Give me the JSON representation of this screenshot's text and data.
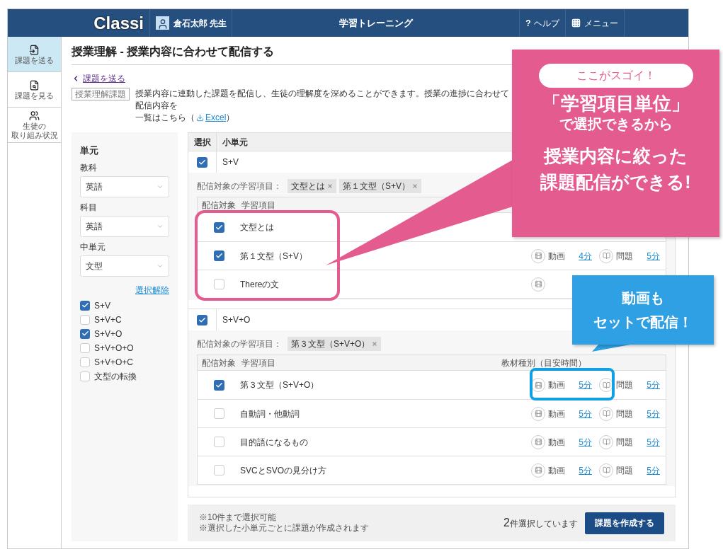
{
  "header": {
    "logo": "Classi",
    "user": "倉石太郎 先生",
    "title": "学習トレーニング",
    "help": {
      "mark": "?",
      "label": "ヘルプ"
    },
    "menu": "メニュー"
  },
  "rail": [
    {
      "kind": "send",
      "lines": [
        "課題を送る"
      ],
      "selected": true
    },
    {
      "kind": "view",
      "lines": [
        "課題を見る"
      ],
      "selected": false
    },
    {
      "kind": "students",
      "lines": [
        "生徒の",
        "取り組み状況"
      ],
      "selected": false
    }
  ],
  "page_title": "授業理解 - 授業内容に合わせて配信する",
  "back_link": "課題を送る",
  "badge": "授業理解課題",
  "description": "授業内容に連動した課題を配信し、生徒の理解度を深めることができます。授業の進捗に合わせて配信内容を",
  "list_line": {
    "before": "一覧はこちら（",
    "link": "Excel",
    "after": "）"
  },
  "filter": {
    "heading": "単元",
    "selects": [
      {
        "label": "教科",
        "value": "英語"
      },
      {
        "label": "科目",
        "value": "英語"
      },
      {
        "label": "中単元",
        "value": "文型"
      }
    ],
    "clear": "選択解除",
    "options": [
      {
        "label": "S+V",
        "checked": true
      },
      {
        "label": "S+V+C",
        "checked": false
      },
      {
        "label": "S+V+O",
        "checked": true
      },
      {
        "label": "S+V+O+O",
        "checked": false
      },
      {
        "label": "S+V+O+C",
        "checked": false
      },
      {
        "label": "文型の転換",
        "checked": false
      }
    ]
  },
  "table": {
    "columns": [
      "選択",
      "小単元"
    ],
    "groups": [
      {
        "name": "S+V",
        "checked": true,
        "target_label": "配信対象の学習項目：",
        "tags": [
          "文型とは",
          "第１文型（S+V）"
        ],
        "columns": [
          "配信対象",
          "学習項目"
        ],
        "items": [
          {
            "label": "文型とは",
            "checked": true
          },
          {
            "label": "第１文型（S+V）",
            "checked": true,
            "materials": [
              {
                "kind": "video",
                "label": "動画",
                "time": "4分"
              },
              {
                "kind": "problem",
                "label": "問題",
                "time": "5分"
              }
            ]
          },
          {
            "label": "Thereの文",
            "checked": false,
            "materials": [
              {
                "kind": "video"
              }
            ]
          }
        ]
      },
      {
        "name": "S+V+O",
        "checked": true,
        "target_label": "配信対象の学習項目：",
        "tags": [
          "第３文型（S+V+O）"
        ],
        "columns": [
          "配信対象",
          "学習項目",
          "教材種別（目安時間）"
        ],
        "items": [
          {
            "label": "第３文型（S+V+O）",
            "checked": true,
            "materials": [
              {
                "kind": "video",
                "label": "動画",
                "time": "5分"
              },
              {
                "kind": "problem",
                "label": "問題",
                "time": "5分"
              }
            ]
          },
          {
            "label": "自動詞・他動詞",
            "checked": false,
            "materials": [
              {
                "kind": "video",
                "label": "動画",
                "time": "5分"
              },
              {
                "kind": "problem",
                "label": "問題",
                "time": "5分"
              }
            ]
          },
          {
            "label": "目的語になるもの",
            "checked": false,
            "materials": [
              {
                "kind": "video",
                "label": "動画",
                "time": "5分"
              },
              {
                "kind": "problem",
                "label": "問題",
                "time": "5分"
              }
            ]
          },
          {
            "label": "SVCとSVOの見分け方",
            "checked": false,
            "materials": [
              {
                "kind": "video",
                "label": "動画",
                "time": "5分"
              },
              {
                "kind": "problem",
                "label": "問題",
                "time": "5分"
              }
            ]
          }
        ]
      }
    ]
  },
  "footer": {
    "notes": [
      "※10件まで選択可能",
      "※選択した小単元ごとに課題が作成されます"
    ],
    "count": "2",
    "count_suffix": "件選択しています",
    "button": "課題を作成する"
  },
  "callouts": [
    {
      "kind": "pink",
      "badge": "ここがスゴイ！",
      "lines": [
        "「学習項目単位」",
        "で選択できるから",
        "授業内容に絞った",
        "課題配信ができる!"
      ]
    },
    {
      "kind": "blue",
      "lines": [
        "動画も",
        "セットで配信！"
      ]
    }
  ]
}
